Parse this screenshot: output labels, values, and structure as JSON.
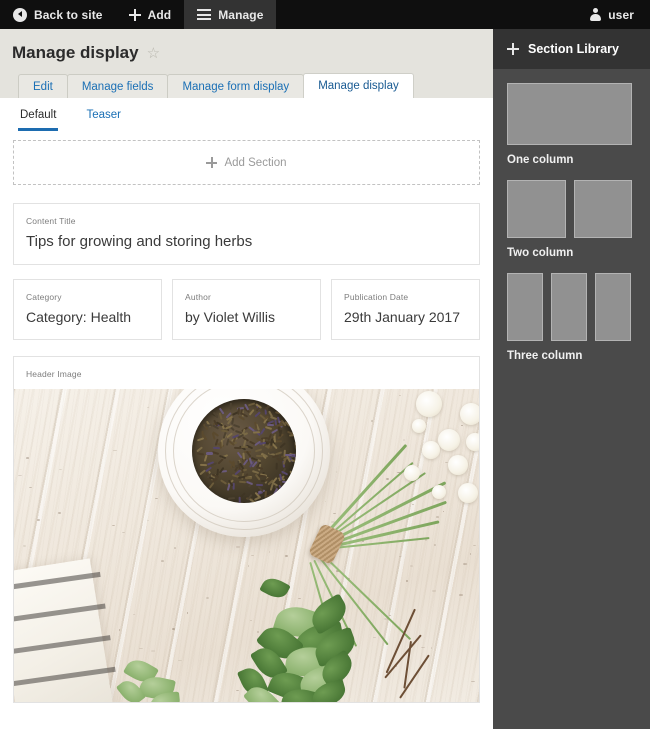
{
  "toolbar": {
    "back_label": "Back to site",
    "add_label": "Add",
    "manage_label": "Manage",
    "user_label": "user",
    "back_icon": "back-circle-icon",
    "add_icon": "plus-icon",
    "manage_icon": "hamburger-icon",
    "user_icon": "user-icon",
    "bg_color": "#0f0f0f",
    "active_bg_color": "#333333"
  },
  "page": {
    "title": "Manage display",
    "star_icon": "star-outline-icon",
    "star_glyph": "☆",
    "bg_color": "#e4e3dd"
  },
  "primary_tabs": [
    {
      "label": "Edit",
      "active": false
    },
    {
      "label": "Manage fields",
      "active": false
    },
    {
      "label": "Manage form display",
      "active": false
    },
    {
      "label": "Manage display",
      "active": true
    }
  ],
  "secondary_tabs": [
    {
      "label": "Default",
      "active": true
    },
    {
      "label": "Teaser",
      "active": false
    }
  ],
  "add_section": {
    "label": "Add Section",
    "icon": "plus-icon"
  },
  "fields": {
    "title": {
      "label": "Content Title",
      "value": "Tips for growing and storing herbs"
    },
    "category": {
      "label": "Category",
      "value": "Category: Health"
    },
    "author": {
      "label": "Author",
      "value": "by Violet Willis"
    },
    "publication_date": {
      "label": "Publication Date",
      "value": "29th January 2017"
    },
    "header_image": {
      "label": "Header Image",
      "alt": "Dried lavender buds in a white ceramic bowl on whitewashed wooden planks, with a tied bundle of green herbs and white flowers and a striped linen cloth"
    }
  },
  "library": {
    "title": "Section Library",
    "add_icon": "plus-icon",
    "header_bg": "#333333",
    "panel_bg": "#4a4a4a",
    "thumb_color": "#919191",
    "items": [
      {
        "label": "One column",
        "columns": 1
      },
      {
        "label": "Two column",
        "columns": 2
      },
      {
        "label": "Three column",
        "columns": 3
      }
    ]
  }
}
